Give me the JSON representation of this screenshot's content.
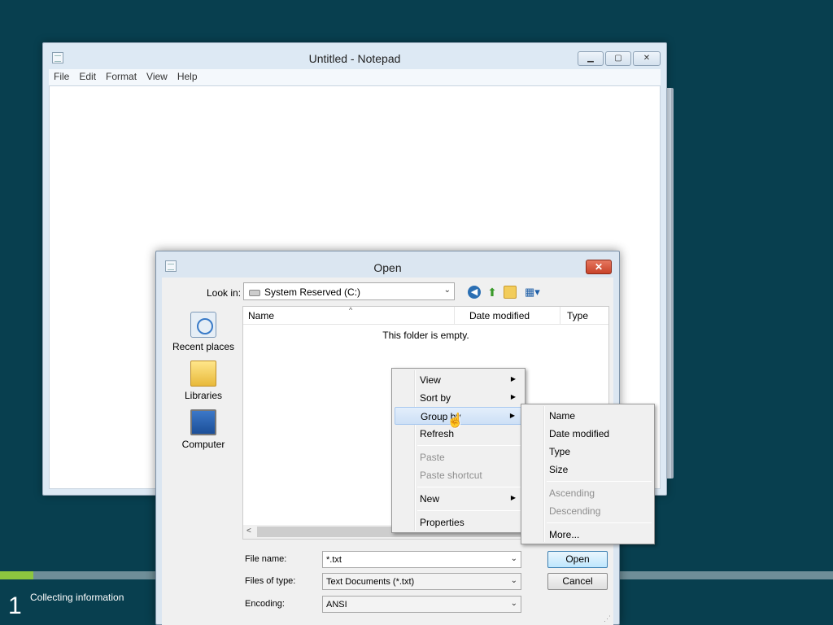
{
  "setup": {
    "step_number": "1",
    "status": "Collecting information",
    "progress": 0.04
  },
  "notepad": {
    "title": "Untitled - Notepad",
    "menu": [
      "File",
      "Edit",
      "Format",
      "View",
      "Help"
    ],
    "content": ""
  },
  "dialog": {
    "title": "Open",
    "look_in_label": "Look in:",
    "look_in_value": "System Reserved (C:)",
    "places": [
      "Recent places",
      "Libraries",
      "Computer"
    ],
    "columns": [
      "Name",
      "Date modified",
      "Type"
    ],
    "empty_message": "This folder is empty.",
    "file_name_label": "File name:",
    "file_name_value": "*.txt",
    "files_of_type_label": "Files of type:",
    "files_of_type_value": "Text Documents (*.txt)",
    "encoding_label": "Encoding:",
    "encoding_value": "ANSI",
    "open_button": "Open",
    "cancel_button": "Cancel"
  },
  "context_menu": {
    "items": [
      "View",
      "Sort by",
      "Group by",
      "Refresh",
      "Paste",
      "Paste shortcut",
      "New",
      "Properties"
    ],
    "highlighted": "Group by"
  },
  "submenu": {
    "items": [
      "Name",
      "Date modified",
      "Type",
      "Size",
      "Ascending",
      "Descending",
      "More..."
    ]
  },
  "colors": {
    "desktop": "#083f4f",
    "progress": "#8cc63f",
    "window_frame": "#dde9f4",
    "close_red": "#c8432a"
  }
}
